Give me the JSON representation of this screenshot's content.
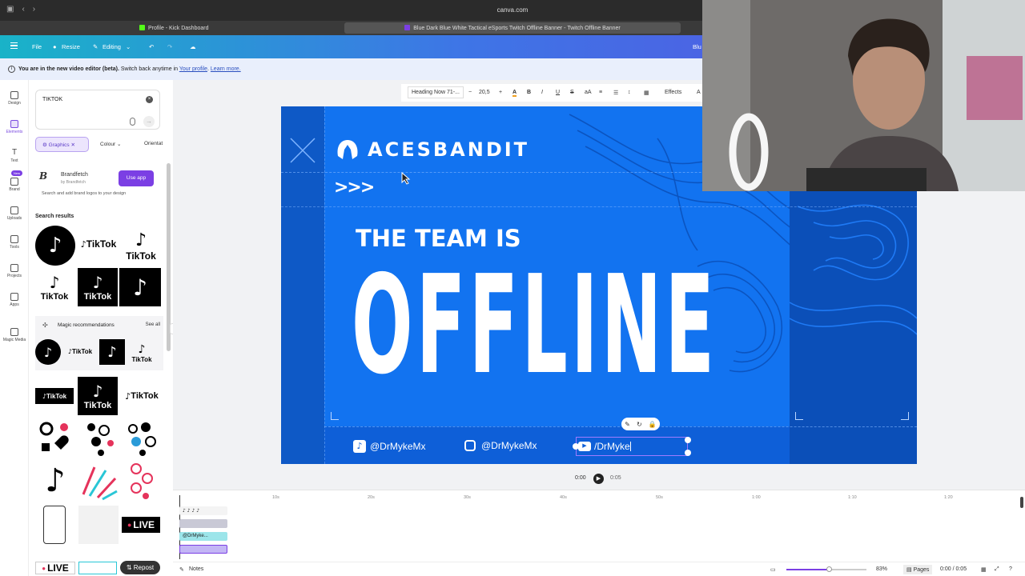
{
  "browser": {
    "url": "canva.com",
    "tabs": [
      {
        "label": "Profile - Kick Dashboard",
        "fav_color": "#53fc18"
      },
      {
        "label": "Blue Dark Blue White Tactical eSports Twitch Offline Banner - Twitch Offline Banner",
        "fav_color": "#7b3fe4"
      }
    ]
  },
  "toolbar": {
    "file": "File",
    "resize": "Resize",
    "editing": "Editing",
    "right_title": "Blu"
  },
  "notice": {
    "bold": "You are in the new video editor (beta).",
    "rest": " Switch back anytime in ",
    "link1": "Your profile",
    "sep": ". ",
    "link2": "Learn more."
  },
  "rail": [
    "Design",
    "Elements",
    "Text",
    "Brand",
    "Uploads",
    "Tools",
    "Projects",
    "Apps",
    "Magic Media"
  ],
  "rail_new": "New",
  "search": {
    "value": "TIKTOK"
  },
  "chips": {
    "graphics": "Graphics",
    "colour": "Colour",
    "orientation": "Orientat"
  },
  "brandfetch": {
    "name": "Brandfetch",
    "by": "by Brandfetch",
    "use": "Use app",
    "desc": "Search and add brand logos to your design"
  },
  "results_title": "Search results",
  "magic_title": "Magic recommendations",
  "see_all": "See all",
  "tiktok_word": "TikTok",
  "live_label": "LIVE",
  "repost_label": "Repost",
  "format": {
    "font": "Heading Now 71-...",
    "size": "20,5",
    "minus": "−",
    "plus": "+",
    "effects": "Effects",
    "tail": "A"
  },
  "banner": {
    "brand": "ACESBANDIT",
    "arrows": ">>>",
    "line1": "THE TEAM IS",
    "line2": "OFFLINE",
    "socials": [
      {
        "icon": "tiktok-icon",
        "handle": "@DrMykeMx"
      },
      {
        "icon": "instagram-icon",
        "handle": "@DrMykeMx"
      },
      {
        "icon": "youtube-icon",
        "handle": "/DrMyke"
      }
    ]
  },
  "playback": {
    "current": "0:00",
    "duration": "0:05"
  },
  "ruler": [
    "10s",
    "20s",
    "30s",
    "40s",
    "50s",
    "1:00",
    "1:10",
    "1:20"
  ],
  "timeline_text_track": "@DrMyke...",
  "bottom": {
    "notes": "Notes",
    "zoom": "83%",
    "pages": "Pages",
    "time": "0:00 / 0:05"
  },
  "colors": {
    "accent": "#7b3fe4",
    "banner_blue": "#1273f0",
    "banner_dark": "#0e59c6"
  }
}
